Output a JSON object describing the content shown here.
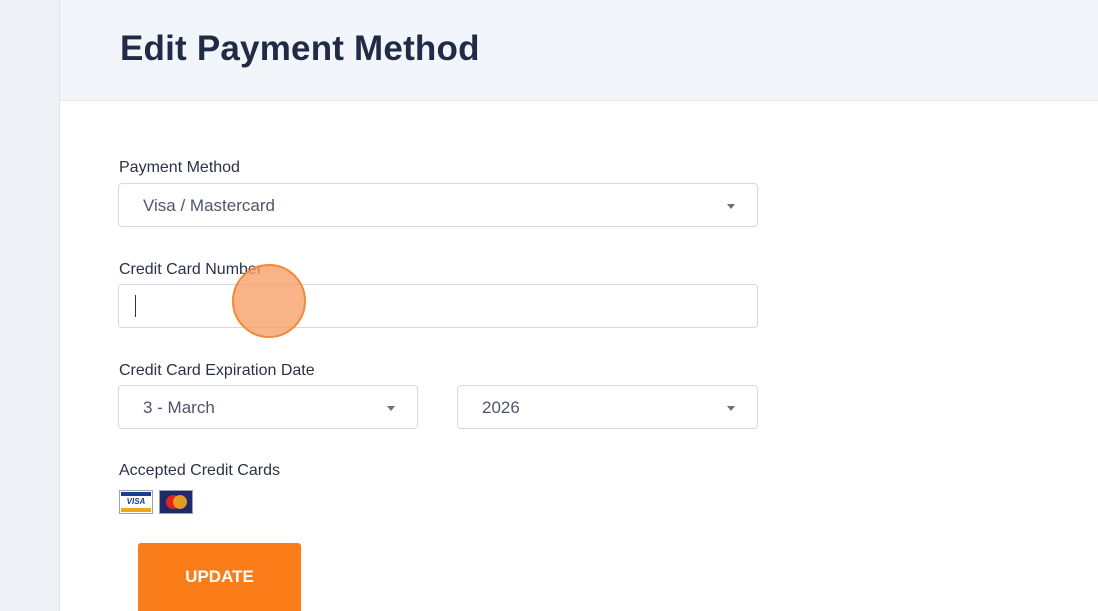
{
  "header": {
    "title": "Edit Payment Method"
  },
  "form": {
    "payment_method": {
      "label": "Payment Method",
      "value": "Visa / Mastercard"
    },
    "card_number": {
      "label": "Credit Card Number",
      "value": ""
    },
    "expiration": {
      "label": "Credit Card Expiration Date",
      "month_value": "3 - March",
      "year_value": "2026"
    },
    "accepted_cards": {
      "label": "Accepted Credit Cards",
      "logos": [
        "visa-card-icon",
        "mastercard-icon"
      ],
      "visa_mark": "VISA"
    },
    "submit_label": "UPDATE"
  },
  "colors": {
    "accent": "#fb7d1a",
    "title": "#222b45",
    "header_bg": "#f2f5fa",
    "click_marker": "#f08a3a"
  }
}
